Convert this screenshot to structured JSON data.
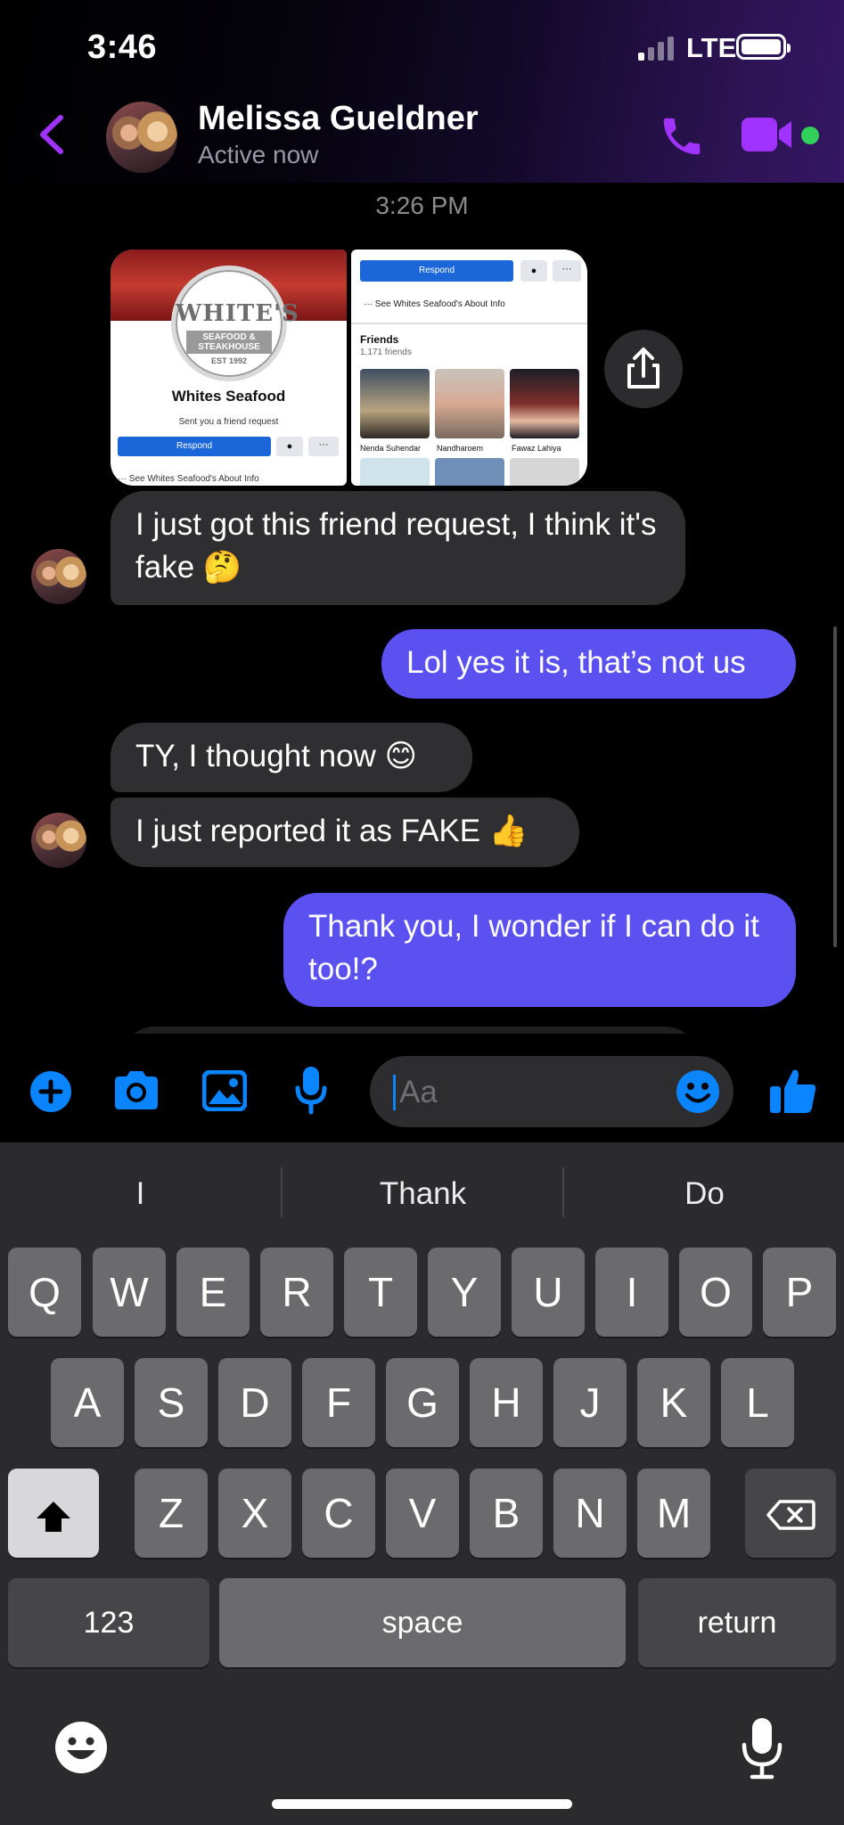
{
  "status_bar": {
    "time": "3:46",
    "network": "LTE"
  },
  "header": {
    "name": "Melissa Gueldner",
    "status": "Active now"
  },
  "chat": {
    "timestamp": "3:26 PM",
    "attachment_1": {
      "logo_big": "WHITE'S",
      "logo_small": "SEAFOOD & STEAKHOUSE",
      "logo_est": "EST 1992",
      "name": "Whites Seafood",
      "subtitle": "Sent you a friend request",
      "respond": "Respond",
      "more": "···",
      "footer": "···  See Whites Seafood's About Info"
    },
    "attachment_2": {
      "respond": "Respond",
      "more": "···",
      "about": "···  See Whites Seafood's About Info",
      "friends_title": "Friends",
      "friends_count": "1,171 friends",
      "friends": [
        "Nenda Suhendar",
        "Nandharoem",
        "Fawaz Lahiya"
      ]
    },
    "messages": [
      {
        "side": "in",
        "text": "I just got this friend request, I think it's fake 🤔"
      },
      {
        "side": "out",
        "text": "Lol yes it is, that’s not us"
      },
      {
        "side": "in",
        "text": "TY, I thought now 😊"
      },
      {
        "side": "in",
        "text": "I just reported it as FAKE 👍"
      },
      {
        "side": "out",
        "text": "Thank you, I wonder if I can do it too!?"
      }
    ]
  },
  "composer": {
    "placeholder": "Aa"
  },
  "keyboard": {
    "suggestions": [
      "I",
      "Thank",
      "Do"
    ],
    "row1": [
      "Q",
      "W",
      "E",
      "R",
      "T",
      "Y",
      "U",
      "I",
      "O",
      "P"
    ],
    "row2": [
      "A",
      "S",
      "D",
      "F",
      "G",
      "H",
      "J",
      "K",
      "L"
    ],
    "row3": [
      "Z",
      "X",
      "C",
      "V",
      "B",
      "N",
      "M"
    ],
    "numbers": "123",
    "space": "space",
    "return": "return"
  },
  "colors": {
    "accent": "#a033ff",
    "outgoing": "#5b51f0",
    "incoming": "#2f2f31",
    "messenger_blue": "#0a84ff",
    "online": "#31d05b"
  }
}
